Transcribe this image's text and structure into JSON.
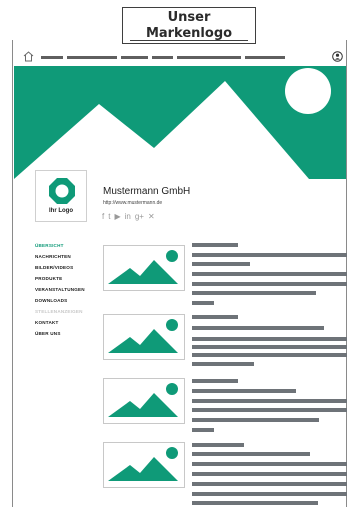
{
  "header_label": {
    "line1": "Unser",
    "line2": "Markenlogo"
  },
  "icons": {
    "home": "home-icon",
    "user": "user-icon"
  },
  "colors": {
    "brand": "#0f9a78",
    "placeholder_text": "#6e7378"
  },
  "profile": {
    "logo_text": "Ihr Logo"
  },
  "company": {
    "name": "Mustermann GmbH",
    "url": "http://www.mustermann.de"
  },
  "social": {
    "facebook": "f",
    "twitter": "t",
    "youtube": "▶",
    "linkedin": "in",
    "googleplus": "g+",
    "xing": "✕"
  },
  "sidebar": {
    "items": [
      {
        "label": "ÜBERSICHT"
      },
      {
        "label": "NACHRICHTEN"
      },
      {
        "label": "BILDER/VIDEOS"
      },
      {
        "label": "PRODUKTE"
      },
      {
        "label": "VERANSTALTUNGEN"
      },
      {
        "label": "DOWNLOADS"
      },
      {
        "label": "STELLENANZEIGEN"
      },
      {
        "label": "KONTAKT"
      },
      {
        "label": "ÜBER UNS"
      }
    ]
  }
}
